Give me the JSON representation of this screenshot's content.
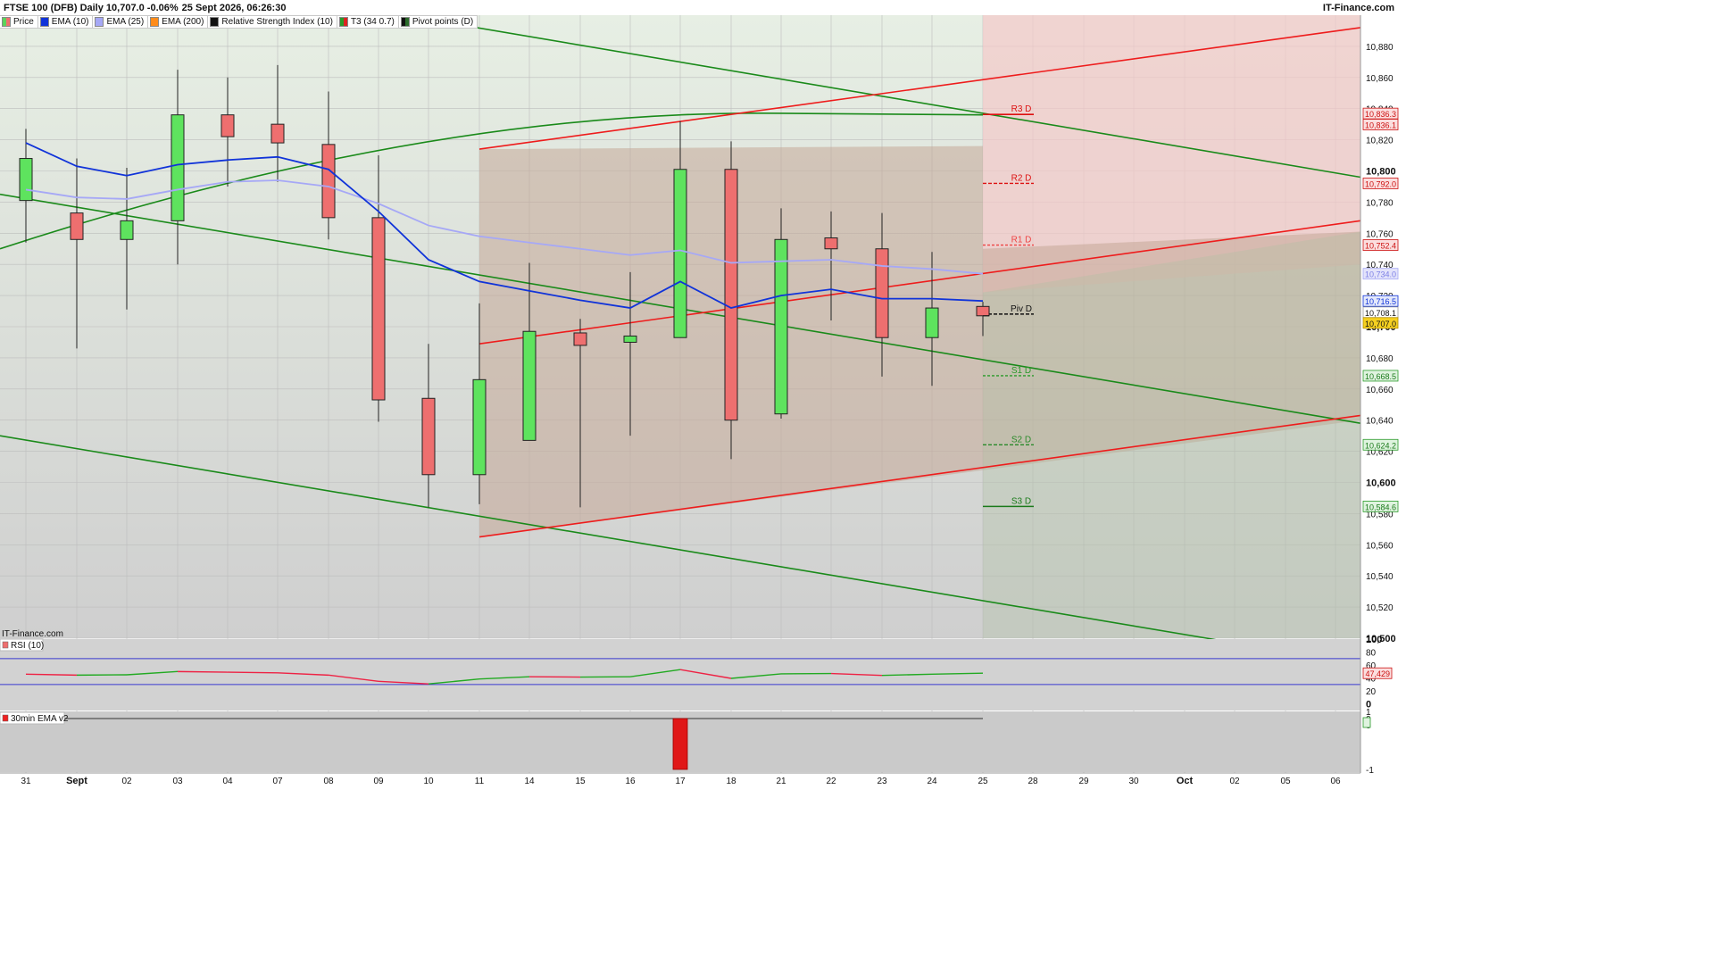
{
  "header": {
    "instrument": "FTSE 100 (DFB) Daily 10,707.0 -0.06%",
    "datetime": "25 Sept 2026, 06:26:30",
    "brand": "IT-Finance.com"
  },
  "legend": [
    {
      "label": "Price",
      "color": "#5bd35b"
    },
    {
      "label": "EMA (10)",
      "color": "#1033d9"
    },
    {
      "label": "EMA (25)",
      "color": "#a6a8f6"
    },
    {
      "label": "EMA (200)",
      "color": "#ff8c1a"
    },
    {
      "label": "Relative Strength Index (10)",
      "color": "#111111"
    },
    {
      "label": "T3 (34 0.7)",
      "color": "#d22"
    },
    {
      "label": "Pivot points (D)",
      "color": "#2a6a2a"
    }
  ],
  "watermark": "IT-Finance.com",
  "rsi_panel_label": "RSI (10)",
  "ema_panel_label": "30min EMA v2",
  "colors": {
    "bull": "#5ee35e",
    "bear": "#ee6f6f",
    "ema10": "#1033d9",
    "ema25": "#a6a8f6",
    "channel_green": "#1a8a1a",
    "channel_red": "#ee1c1c",
    "rsi_line_up": "#22aa22",
    "rsi_line_down": "#ee2244"
  },
  "chart_data": [
    {
      "type": "candlestick",
      "title": "FTSE 100 (DFB) Daily",
      "ylim": [
        10500,
        10900
      ],
      "ytick_labels": [
        "10,500",
        "10,520",
        "10,540",
        "10,560",
        "10,580",
        "10,600",
        "10,620",
        "10,640",
        "10,660",
        "10,680",
        "10,700",
        "10,720",
        "10,740",
        "10,760",
        "10,780",
        "10,800",
        "10,820",
        "10,840",
        "10,860",
        "10,880"
      ],
      "xtick_labels": [
        "31",
        "Sept",
        "02",
        "03",
        "04",
        "07",
        "08",
        "09",
        "10",
        "11",
        "14",
        "15",
        "16",
        "17",
        "18",
        "21",
        "22",
        "23",
        "24",
        "25",
        "28",
        "29",
        "30",
        "Oct",
        "02",
        "05",
        "06"
      ],
      "candles": [
        {
          "date": "31",
          "open": 10781,
          "high": 10827,
          "low": 10754,
          "close": 10808
        },
        {
          "date": "Sept",
          "open": 10773,
          "high": 10808,
          "low": 10686,
          "close": 10756
        },
        {
          "date": "02",
          "open": 10756,
          "high": 10802,
          "low": 10711,
          "close": 10768
        },
        {
          "date": "03",
          "open": 10768,
          "high": 10865,
          "low": 10740,
          "close": 10836
        },
        {
          "date": "04",
          "open": 10836,
          "high": 10860,
          "low": 10790,
          "close": 10822
        },
        {
          "date": "07",
          "open": 10830,
          "high": 10868,
          "low": 10793,
          "close": 10818
        },
        {
          "date": "08",
          "open": 10817,
          "high": 10851,
          "low": 10756,
          "close": 10770
        },
        {
          "date": "09",
          "open": 10770,
          "high": 10810,
          "low": 10639,
          "close": 10653
        },
        {
          "date": "10",
          "open": 10654,
          "high": 10689,
          "low": 10584,
          "close": 10605
        },
        {
          "date": "11",
          "open": 10605,
          "high": 10715,
          "low": 10586,
          "close": 10666
        },
        {
          "date": "14",
          "open": 10627,
          "high": 10741,
          "low": 10627,
          "close": 10697
        },
        {
          "date": "15",
          "open": 10696,
          "high": 10705,
          "low": 10584,
          "close": 10688
        },
        {
          "date": "16",
          "open": 10690,
          "high": 10735,
          "low": 10630,
          "close": 10694
        },
        {
          "date": "17",
          "open": 10693,
          "high": 10832,
          "low": 10693,
          "close": 10801
        },
        {
          "date": "18",
          "open": 10801,
          "high": 10819,
          "low": 10615,
          "close": 10640
        },
        {
          "date": "21",
          "open": 10644,
          "high": 10776,
          "low": 10641,
          "close": 10756
        },
        {
          "date": "22",
          "open": 10757,
          "high": 10774,
          "low": 10704,
          "close": 10750
        },
        {
          "date": "23",
          "open": 10750,
          "high": 10773,
          "low": 10668,
          "close": 10693
        },
        {
          "date": "24",
          "open": 10693,
          "high": 10748,
          "low": 10662,
          "close": 10712
        },
        {
          "date": "25",
          "open": 10713,
          "high": 10716,
          "low": 10694,
          "close": 10707
        }
      ],
      "series": [
        {
          "name": "EMA (10)",
          "values": [
            10818,
            10803,
            10797,
            10804,
            10807,
            10809,
            10801,
            10774,
            10743,
            10729,
            10723,
            10717,
            10712,
            10729,
            10712,
            10720,
            10724,
            10718,
            10718,
            10716.5
          ]
        },
        {
          "name": "EMA (25)",
          "values": [
            10788,
            10783,
            10782,
            10788,
            10793,
            10794,
            10790,
            10779,
            10765,
            10758,
            10754,
            10750,
            10746,
            10749,
            10741,
            10742,
            10743,
            10739,
            10737,
            10734.0
          ]
        }
      ],
      "pivots": [
        {
          "label": "R3 D",
          "value": 10836.3
        },
        {
          "label": "R2 D",
          "value": 10792.0
        },
        {
          "label": "R1 D",
          "value": 10752.4
        },
        {
          "label": "Piv D",
          "value": 10708.1
        },
        {
          "label": "S1 D",
          "value": 10668.5
        },
        {
          "label": "S2 D",
          "value": 10624.2
        },
        {
          "label": "S3 D",
          "value": 10584.6
        }
      ],
      "price_tags": [
        "10,836.3",
        "10,836.1",
        "10,792.0",
        "10,752.4",
        "10,734.0",
        "10,716.5",
        "10,708.1",
        "10,707.0",
        "10,668.5",
        "10,624.2",
        "10,584.6"
      ]
    },
    {
      "type": "line",
      "title": "RSI (10)",
      "ylim": [
        -10,
        100
      ],
      "ytick_labels": [
        "100",
        "80",
        "60",
        "40",
        "20",
        "0"
      ],
      "reference_lines": [
        70,
        30
      ],
      "values": [
        46,
        44.5,
        45,
        50,
        49,
        48,
        44.5,
        35,
        31,
        38.5,
        42,
        41.5,
        42,
        53,
        39.5,
        46.5,
        47,
        44,
        46,
        47.429
      ],
      "last_label": "47,429"
    },
    {
      "type": "bar",
      "title": "30min EMA v2",
      "ylim": [
        -1,
        1
      ],
      "ytick_labels": [
        "1",
        "0",
        "0",
        "-1"
      ],
      "values": [
        0,
        0,
        0,
        0,
        0,
        0,
        0,
        0,
        0,
        0,
        0,
        0,
        0,
        -1,
        0,
        0,
        0,
        0,
        0,
        0
      ]
    }
  ]
}
